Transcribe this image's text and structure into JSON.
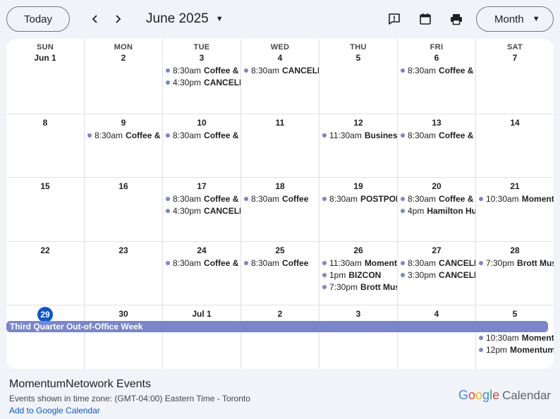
{
  "toolbar": {
    "today_label": "Today",
    "prev_icon": "chevron-left-icon",
    "next_icon": "chevron-right-icon",
    "month_label": "June 2025",
    "view_label": "Month",
    "icons": [
      "feedback-icon",
      "calendar-icon",
      "print-icon"
    ]
  },
  "calendar": {
    "weekday_labels": [
      "SUN",
      "MON",
      "TUE",
      "WED",
      "THU",
      "FRI",
      "SAT"
    ],
    "weeks": [
      [
        {
          "label": "Jun 1",
          "events": []
        },
        {
          "label": "2",
          "events": []
        },
        {
          "label": "3",
          "events": [
            {
              "time": "8:30am",
              "title": "Coffee & Connect"
            },
            {
              "time": "4:30pm",
              "title": "CANCELLED"
            }
          ]
        },
        {
          "label": "4",
          "events": [
            {
              "time": "8:30am",
              "title": "CANCELLED"
            }
          ]
        },
        {
          "label": "5",
          "events": []
        },
        {
          "label": "6",
          "events": [
            {
              "time": "8:30am",
              "title": "Coffee & Connect"
            }
          ]
        },
        {
          "label": "7",
          "events": []
        }
      ],
      [
        {
          "label": "8",
          "events": []
        },
        {
          "label": "9",
          "events": [
            {
              "time": "8:30am",
              "title": "Coffee & Connect"
            }
          ]
        },
        {
          "label": "10",
          "events": [
            {
              "time": "8:30am",
              "title": "Coffee & Connect"
            }
          ]
        },
        {
          "label": "11",
          "events": []
        },
        {
          "label": "12",
          "events": [
            {
              "time": "11:30am",
              "title": "Business"
            }
          ]
        },
        {
          "label": "13",
          "events": [
            {
              "time": "8:30am",
              "title": "Coffee & Connect"
            }
          ]
        },
        {
          "label": "14",
          "events": []
        }
      ],
      [
        {
          "label": "15",
          "events": []
        },
        {
          "label": "16",
          "events": []
        },
        {
          "label": "17",
          "events": [
            {
              "time": "8:30am",
              "title": "Coffee & Connect"
            },
            {
              "time": "4:30pm",
              "title": "CANCELLED"
            }
          ]
        },
        {
          "label": "18",
          "events": [
            {
              "time": "8:30am",
              "title": "Coffee"
            }
          ]
        },
        {
          "label": "19",
          "events": [
            {
              "time": "8:30am",
              "title": "POSTPONED"
            }
          ]
        },
        {
          "label": "20",
          "events": [
            {
              "time": "8:30am",
              "title": "Coffee & Connect"
            },
            {
              "time": "4pm",
              "title": "Hamilton Hub"
            }
          ]
        },
        {
          "label": "21",
          "events": [
            {
              "time": "10:30am",
              "title": "Momentum"
            }
          ]
        }
      ],
      [
        {
          "label": "22",
          "events": []
        },
        {
          "label": "23",
          "events": []
        },
        {
          "label": "24",
          "events": [
            {
              "time": "8:30am",
              "title": "Coffee & Connect"
            }
          ]
        },
        {
          "label": "25",
          "events": [
            {
              "time": "8:30am",
              "title": "Coffee"
            }
          ]
        },
        {
          "label": "26",
          "events": [
            {
              "time": "11:30am",
              "title": "Momentum"
            },
            {
              "time": "1pm",
              "title": "BIZCON"
            },
            {
              "time": "7:30pm",
              "title": "Brott Music"
            }
          ]
        },
        {
          "label": "27",
          "events": [
            {
              "time": "8:30am",
              "title": "CANCELLED"
            },
            {
              "time": "3:30pm",
              "title": "CANCELLED"
            }
          ]
        },
        {
          "label": "28",
          "events": [
            {
              "time": "7:30pm",
              "title": "Brott Music"
            }
          ]
        }
      ],
      [
        {
          "label": "29",
          "events": [],
          "today": true
        },
        {
          "label": "30",
          "events": []
        },
        {
          "label": "Jul 1",
          "events": []
        },
        {
          "label": "2",
          "events": []
        },
        {
          "label": "3",
          "events": []
        },
        {
          "label": "4",
          "events": []
        },
        {
          "label": "5",
          "events": [
            {
              "time": "10:30am",
              "title": "Momentum"
            },
            {
              "time": "12pm",
              "title": "Momentum"
            }
          ]
        }
      ]
    ],
    "allday_banner": "Third Quarter Out-of-Office Week",
    "event_color": "#7986cb",
    "today_color": "#0b57d0"
  },
  "footer": {
    "title": "MomentumNetowork Events",
    "timezone": "Events shown in time zone: (GMT-04:00) Eastern Time - Toronto",
    "add_link": "Add to Google Calendar",
    "brand_google": "Google",
    "brand_calendar": "Calendar"
  }
}
